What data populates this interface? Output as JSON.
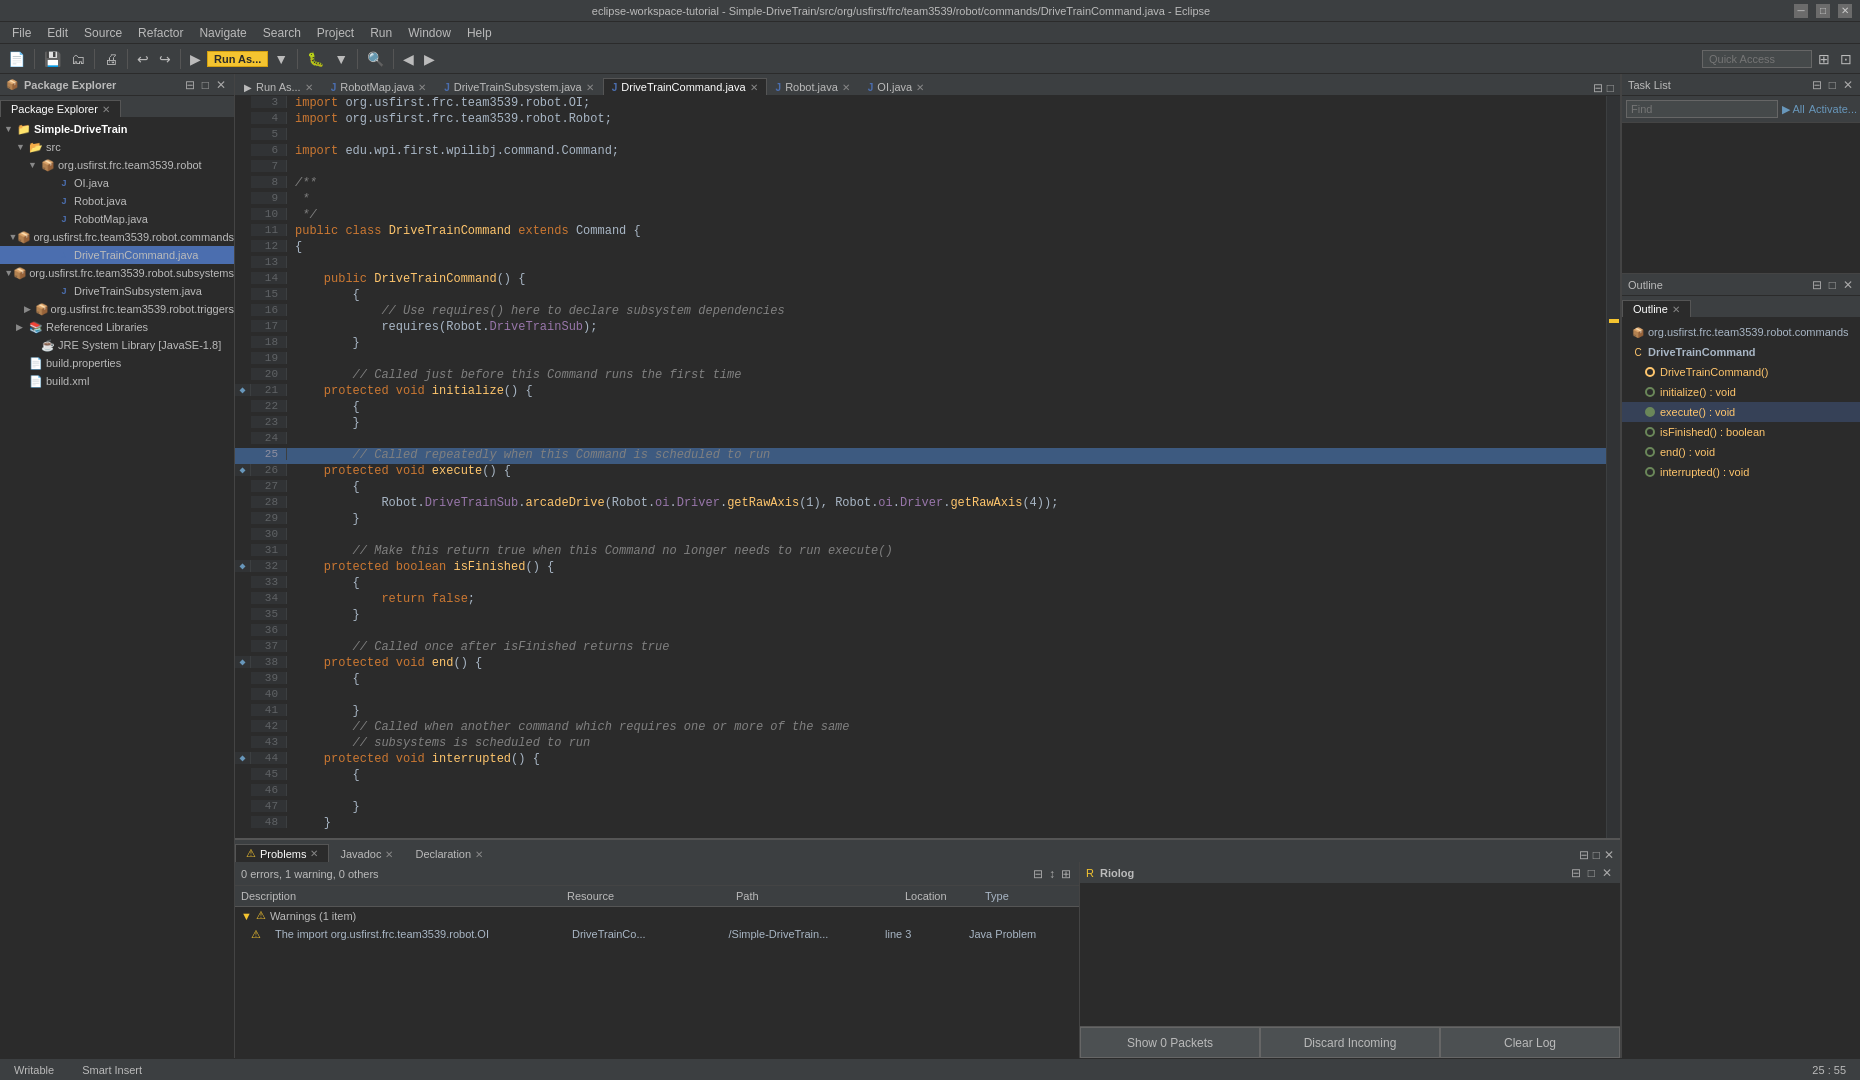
{
  "window": {
    "title": "eclipse-workspace-tutorial - Simple-DriveTrain/src/org/usfirst/frc/team3539/robot/commands/DriveTrainCommand.java - Eclipse"
  },
  "menu": {
    "items": [
      "File",
      "Edit",
      "Source",
      "Refactor",
      "Navigate",
      "Search",
      "Project",
      "Run",
      "Window",
      "Help"
    ]
  },
  "toolbar": {
    "run_label": "Run As...",
    "quick_access_placeholder": "Quick Access"
  },
  "package_explorer": {
    "title": "Package Explorer",
    "items": [
      {
        "label": "Simple-DriveTrain",
        "level": 0,
        "type": "project",
        "expanded": true
      },
      {
        "label": "src",
        "level": 1,
        "type": "folder",
        "expanded": true
      },
      {
        "label": "org.usfirst.frc.team3539.robot",
        "level": 2,
        "type": "package",
        "expanded": true
      },
      {
        "label": "OI.java",
        "level": 3,
        "type": "java"
      },
      {
        "label": "Robot.java",
        "level": 3,
        "type": "java"
      },
      {
        "label": "RobotMap.java",
        "level": 3,
        "type": "java"
      },
      {
        "label": "org.usfirst.frc.team3539.robot.commands",
        "level": 2,
        "type": "package",
        "expanded": true
      },
      {
        "label": "DriveTrainCommand.java",
        "level": 3,
        "type": "java",
        "selected": true
      },
      {
        "label": "org.usfirst.frc.team3539.robot.subsystems",
        "level": 2,
        "type": "package",
        "expanded": true
      },
      {
        "label": "DriveTrainSubsystem.java",
        "level": 3,
        "type": "java"
      },
      {
        "label": "org.usfirst.frc.team3539.robot.triggers",
        "level": 2,
        "type": "package"
      },
      {
        "label": "Referenced Libraries",
        "level": 1,
        "type": "folder"
      },
      {
        "label": "JRE System Library [JavaSE-1.8]",
        "level": 2,
        "type": "lib"
      },
      {
        "label": "build.properties",
        "level": 1,
        "type": "file"
      },
      {
        "label": "build.xml",
        "level": 1,
        "type": "file"
      }
    ]
  },
  "editor": {
    "tabs": [
      {
        "label": "Run As...",
        "active": false,
        "icon": "▶"
      },
      {
        "label": "RobotMap.java",
        "active": false,
        "icon": "J"
      },
      {
        "label": "DriveTrainSubsystem.java",
        "active": false,
        "icon": "J"
      },
      {
        "label": "DriveTrainCommand.java",
        "active": true,
        "icon": "J"
      },
      {
        "label": "Robot.java",
        "active": false,
        "icon": "J"
      },
      {
        "label": "OI.java",
        "active": false,
        "icon": "J"
      }
    ],
    "code_lines": [
      {
        "num": 3,
        "content": "import org.usfirst.frc.team3539.robot.OI;",
        "gutter": ""
      },
      {
        "num": 4,
        "content": "import org.usfirst.frc.team3539.robot.Robot;",
        "gutter": ""
      },
      {
        "num": 5,
        "content": "",
        "gutter": ""
      },
      {
        "num": 6,
        "content": "import edu.wpi.first.wpilibj.command.Command;",
        "gutter": ""
      },
      {
        "num": 7,
        "content": "",
        "gutter": ""
      },
      {
        "num": 8,
        "content": "/**",
        "gutter": ""
      },
      {
        "num": 9,
        "content": " *",
        "gutter": ""
      },
      {
        "num": 10,
        "content": " */",
        "gutter": ""
      },
      {
        "num": 11,
        "content": "public class DriveTrainCommand extends Command {",
        "gutter": ""
      },
      {
        "num": 12,
        "content": "{",
        "gutter": ""
      },
      {
        "num": 13,
        "content": "",
        "gutter": ""
      },
      {
        "num": 14,
        "content": "    public DriveTrainCommand() {",
        "gutter": ""
      },
      {
        "num": 15,
        "content": "        {",
        "gutter": ""
      },
      {
        "num": 16,
        "content": "            // Use requires() here to declare subsystem dependencies",
        "gutter": ""
      },
      {
        "num": 17,
        "content": "            requires(Robot.DriveTrainSub);",
        "gutter": ""
      },
      {
        "num": 18,
        "content": "        }",
        "gutter": ""
      },
      {
        "num": 19,
        "content": "",
        "gutter": ""
      },
      {
        "num": 20,
        "content": "        // Called just before this Command runs the first time",
        "gutter": ""
      },
      {
        "num": 21,
        "content": "    protected void initialize() {",
        "gutter": "◆"
      },
      {
        "num": 22,
        "content": "        {",
        "gutter": ""
      },
      {
        "num": 23,
        "content": "        }",
        "gutter": ""
      },
      {
        "num": 24,
        "content": "",
        "gutter": ""
      },
      {
        "num": 25,
        "content": "        // Called repeatedly when this Command is scheduled to run",
        "gutter": "",
        "highlighted": true
      },
      {
        "num": 26,
        "content": "    protected void execute() {",
        "gutter": "◆"
      },
      {
        "num": 27,
        "content": "        {",
        "gutter": ""
      },
      {
        "num": 28,
        "content": "            Robot.DriveTrainSub.arcadeDrive(Robot.oi.Driver.getRawAxis(1), Robot.oi.Driver.getRawAxis(4));",
        "gutter": ""
      },
      {
        "num": 29,
        "content": "        }",
        "gutter": ""
      },
      {
        "num": 30,
        "content": "",
        "gutter": ""
      },
      {
        "num": 31,
        "content": "        // Make this return true when this Command no longer needs to run execute()",
        "gutter": ""
      },
      {
        "num": 32,
        "content": "    protected boolean isFinished() {",
        "gutter": "◆"
      },
      {
        "num": 33,
        "content": "        {",
        "gutter": ""
      },
      {
        "num": 34,
        "content": "            return false;",
        "gutter": ""
      },
      {
        "num": 35,
        "content": "        }",
        "gutter": ""
      },
      {
        "num": 36,
        "content": "",
        "gutter": ""
      },
      {
        "num": 37,
        "content": "        // Called once after isFinished returns true",
        "gutter": ""
      },
      {
        "num": 38,
        "content": "    protected void end() {",
        "gutter": "◆"
      },
      {
        "num": 39,
        "content": "        {",
        "gutter": ""
      },
      {
        "num": 40,
        "content": "",
        "gutter": ""
      },
      {
        "num": 41,
        "content": "        }",
        "gutter": ""
      },
      {
        "num": 42,
        "content": "        // Called when another command which requires one or more of the same",
        "gutter": ""
      },
      {
        "num": 43,
        "content": "        // subsystems is scheduled to run",
        "gutter": ""
      },
      {
        "num": 44,
        "content": "    protected void interrupted() {",
        "gutter": "◆"
      },
      {
        "num": 45,
        "content": "        {",
        "gutter": ""
      },
      {
        "num": 46,
        "content": "",
        "gutter": ""
      },
      {
        "num": 47,
        "content": "        }",
        "gutter": ""
      },
      {
        "num": 48,
        "content": "    }",
        "gutter": ""
      }
    ]
  },
  "outline": {
    "title": "Outline",
    "items": [
      {
        "label": "org.usfirst.frc.team3539.robot.commands",
        "level": 0,
        "type": "package"
      },
      {
        "label": "DriveTrainCommand",
        "level": 1,
        "type": "class",
        "expanded": true
      },
      {
        "label": "DriveTrainCommand()",
        "level": 2,
        "type": "constructor"
      },
      {
        "label": "initialize() : void",
        "level": 2,
        "type": "method"
      },
      {
        "label": "execute() : void",
        "level": 2,
        "type": "method",
        "selected": true
      },
      {
        "label": "isFinished() : boolean",
        "level": 2,
        "type": "method"
      },
      {
        "label": "end() : void",
        "level": 2,
        "type": "method"
      },
      {
        "label": "interrupted() : void",
        "level": 2,
        "type": "method"
      }
    ]
  },
  "task_list": {
    "title": "Task List",
    "find_placeholder": "Find",
    "all_label": "▶ All",
    "activate_label": "Activate..."
  },
  "bottom": {
    "tabs": [
      {
        "label": "Problems",
        "active": true,
        "icon": "!"
      },
      {
        "label": "Javadoc",
        "active": false
      },
      {
        "label": "Declaration",
        "active": false
      }
    ],
    "problems_summary": "0 errors, 1 warning, 0 others",
    "columns": [
      "Description",
      "Resource",
      "Path",
      "Location",
      "Type"
    ],
    "warnings": [
      {
        "group": "Warnings (1 item)",
        "items": [
          {
            "desc": "The import org.usfirst.frc.team3539.robot.OI",
            "resource": "DriveTrainCo...",
            "path": "/Simple-DriveTrain...",
            "location": "line 3",
            "type": "Java Problem"
          }
        ]
      }
    ]
  },
  "riolog": {
    "title": "Riolog",
    "show_packets_label": "Show 0 Packets",
    "discard_incoming_label": "Discard Incoming",
    "clear_log_label": "Clear Log"
  },
  "status_bar": {
    "writable": "Writable",
    "smart_insert": "Smart Insert",
    "position": "25 : 55"
  }
}
